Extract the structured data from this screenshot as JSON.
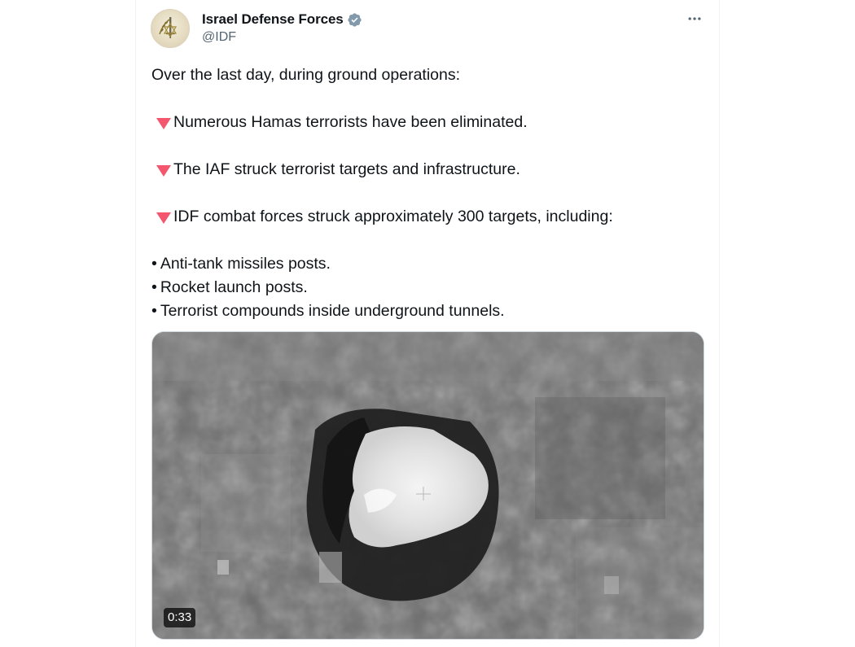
{
  "author": {
    "name": "Israel Defense Forces",
    "handle": "@IDF",
    "verified": true,
    "verified_color": "#829aab"
  },
  "icons": {
    "avatar": "idf-emblem-avatar",
    "verified": "verified-badge-icon",
    "more": "more-options-icon",
    "bullet_marker": "red-triangle-down-icon"
  },
  "accent_colors": {
    "triangle": "#f4566e",
    "handle_text": "#536471"
  },
  "tweet": {
    "intro": "Over the last day, during ground operations:",
    "points": [
      "Numerous Hamas terrorists have been eliminated.",
      "The IAF struck terrorist targets and infrastructure.",
      "IDF combat forces struck approximately 300 targets, including:"
    ],
    "bullets": [
      "Anti-tank missiles posts.",
      "Rocket launch posts.",
      "Terrorist compounds inside underground tunnels."
    ],
    "bullet_char": "•"
  },
  "media": {
    "type": "video",
    "duration": "0:33"
  }
}
